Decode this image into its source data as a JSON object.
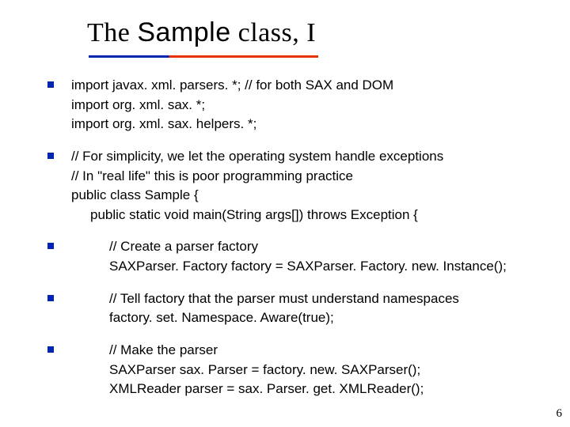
{
  "title": {
    "w1": "The ",
    "w2": "Sample",
    "w3": " class, I"
  },
  "blocks": [
    {
      "lines": [
        {
          "t": "import javax. xml. parsers. *; // for both SAX and DOM",
          "cls": ""
        },
        {
          "t": "import org. xml. sax. *;",
          "cls": ""
        },
        {
          "t": "import org. xml. sax. helpers. *;",
          "cls": ""
        }
      ]
    },
    {
      "lines": [
        {
          "t": "// For simplicity, we let the operating system handle exceptions",
          "cls": ""
        },
        {
          "t": "// In \"real life\" this is poor programming practice",
          "cls": ""
        },
        {
          "t": "public class Sample {",
          "cls": ""
        },
        {
          "t": "public static void main(String args[]) throws Exception {",
          "cls": "ind1"
        }
      ]
    },
    {
      "lines": [
        {
          "t": "// Create a parser factory",
          "cls": "ind2"
        },
        {
          "t": "SAXParser. Factory factory = SAXParser. Factory. new. Instance();",
          "cls": "ind2"
        }
      ]
    },
    {
      "lines": [
        {
          "t": "// Tell factory that the parser must understand namespaces",
          "cls": "ind2"
        },
        {
          "t": "factory. set. Namespace. Aware(true);",
          "cls": "ind2"
        }
      ]
    },
    {
      "lines": [
        {
          "t": "// Make the parser",
          "cls": "ind2"
        },
        {
          "t": "SAXParser sax. Parser = factory. new. SAXParser();",
          "cls": "ind2"
        },
        {
          "t": "XMLReader parser = sax. Parser. get. XMLReader();",
          "cls": "ind2"
        }
      ]
    }
  ],
  "pagenum": "6"
}
